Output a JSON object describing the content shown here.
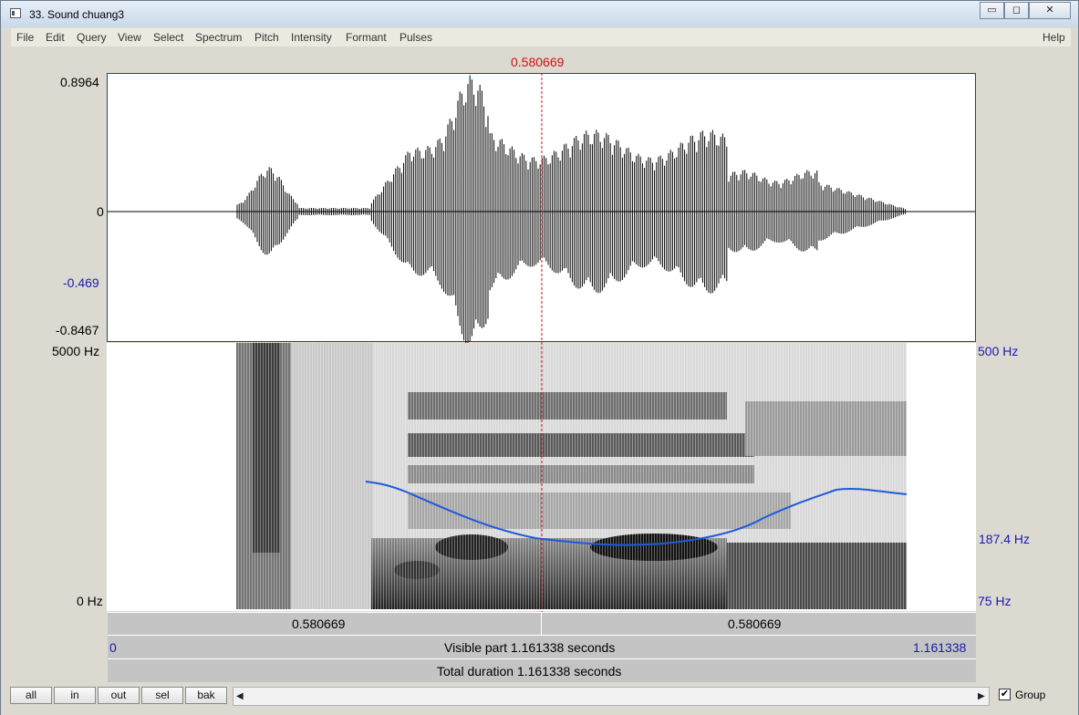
{
  "window": {
    "title": "33. Sound chuang3",
    "controls": {
      "minimize": "▭",
      "maximize": "◻",
      "close": "✕"
    }
  },
  "menu": {
    "items": [
      "File",
      "Edit",
      "Query",
      "View",
      "Select",
      "Spectrum",
      "Pitch",
      "Intensity",
      "Formant",
      "Pulses"
    ],
    "help": "Help"
  },
  "cursor": {
    "time": "0.580669"
  },
  "waveform": {
    "ymax": "0.8964",
    "zero": "0",
    "cursor_value": "-0.469",
    "ymin": "-0.8467"
  },
  "spectrogram": {
    "fmax": "5000 Hz",
    "fmin": "0 Hz",
    "pitch_max": "500 Hz",
    "pitch_value": "187.4 Hz",
    "pitch_min": "75 Hz"
  },
  "bars": {
    "left_part": "0.580669",
    "right_part": "0.580669",
    "visible_start": "0",
    "visible_label": "Visible part 1.161338 seconds",
    "visible_end": "1.161338",
    "total_label": "Total duration 1.161338 seconds"
  },
  "buttons": {
    "all": "all",
    "in": "in",
    "out": "out",
    "sel": "sel",
    "bak": "bak"
  },
  "scrollbar": {
    "left_arrow": "◀",
    "right_arrow": "▶"
  },
  "group": {
    "label": "Group",
    "checked": true
  },
  "colors": {
    "pitch_curve": "#1e5adc",
    "cursor": "#d01010",
    "axis_blue": "#1a1ab0"
  }
}
